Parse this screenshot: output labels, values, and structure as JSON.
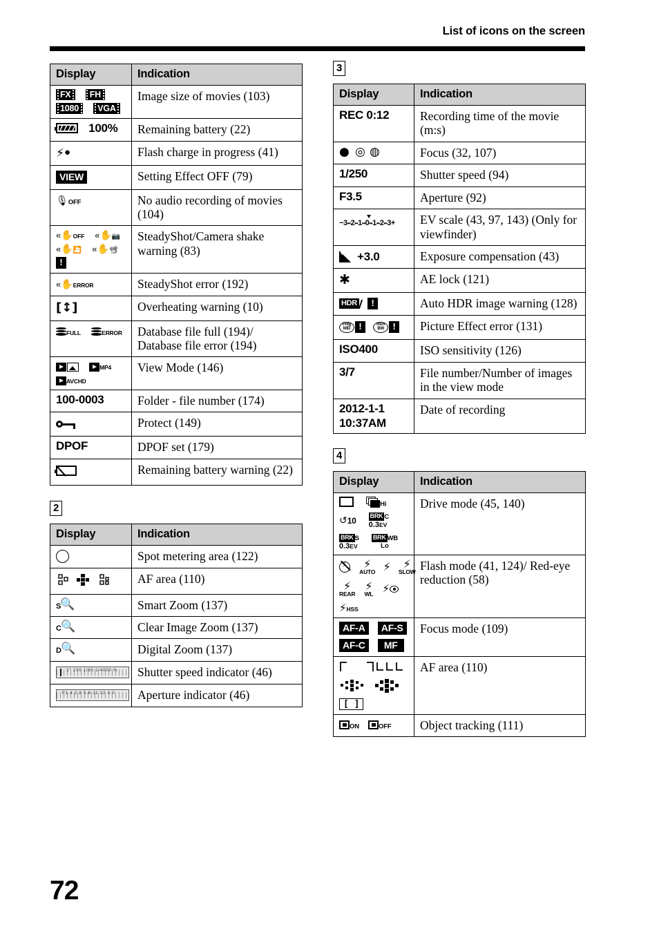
{
  "header": {
    "title": "List of icons on the screen"
  },
  "page_number": "72",
  "columns": {
    "left": {
      "table1": {
        "headers": {
          "display": "Display",
          "indication": "Indication"
        },
        "rows": [
          {
            "icons": "FX / FH / 1080 / VGA film-strip badges",
            "indication": "Image size of movies (103)"
          },
          {
            "icons": "battery-full 100%",
            "indication": "Remaining battery (22)"
          },
          {
            "icons": "flash-charging",
            "indication": "Flash charge in progress (41)"
          },
          {
            "icons": "VIEW",
            "indication": "Setting Effect OFF (79)"
          },
          {
            "icons": "microphone-off",
            "indication": "No audio recording of movies (104)"
          },
          {
            "icons": "steadyshot-variants",
            "indication": "SteadyShot/Camera shake warning (83)"
          },
          {
            "icons": "steadyshot-error",
            "indication": "SteadyShot error (192)"
          },
          {
            "icons": "overheating",
            "indication": "Overheating warning (10)"
          },
          {
            "icons": "database-full / database-error",
            "indication": "Database file full (194)/ Database file error (194)"
          },
          {
            "icons": "view-mode-still / MP4 / AVCHD",
            "indication": "View Mode (146)"
          },
          {
            "icons": "100-0003",
            "indication": "Folder - file number (174)"
          },
          {
            "icons": "protect-key",
            "indication": "Protect (149)"
          },
          {
            "icons": "DPOF",
            "indication": "DPOF set (179)"
          },
          {
            "icons": "battery-empty-warning",
            "indication": "Remaining battery warning (22)"
          }
        ],
        "labels": {
          "film_fx": "FX",
          "film_fh": "FH",
          "film_1080": "1080",
          "film_vga": "VGA",
          "battery_percent": "100%",
          "view_badge": "VIEW",
          "mic_off_sub": "OFF",
          "ss_off_sub": "OFF",
          "ss_error_sub": "ERROR",
          "db_full_sub": "FULL",
          "db_error_sub": "ERROR",
          "vm_mp4_sub": "MP4",
          "vm_avchd_sub": "AVCHD",
          "folder_file": "100-0003",
          "dpof": "DPOF"
        }
      },
      "badge2": "2",
      "table2": {
        "headers": {
          "display": "Display",
          "indication": "Indication"
        },
        "rows": [
          {
            "icons": "spot-metering-circle",
            "indication": "Spot metering area (122)"
          },
          {
            "icons": "af-area-dots",
            "indication": "AF area (110)"
          },
          {
            "icons": "smart-zoom-magnifier",
            "indication": "Smart Zoom (137)"
          },
          {
            "icons": "clear-image-zoom-magnifier",
            "indication": "Clear Image Zoom (137)"
          },
          {
            "icons": "digital-zoom-magnifier",
            "indication": "Digital Zoom (137)"
          },
          {
            "icons": "shutter-speed-scale-strip",
            "indication": "Shutter speed indicator (46)"
          },
          {
            "icons": "aperture-scale-strip",
            "indication": "Aperture indicator (46)"
          }
        ],
        "labels": {
          "smart_prefix": "S",
          "clear_prefix": "C",
          "digital_prefix": "D",
          "shutter_strip_text": "1\" 100  1/60    1/4000 %",
          "aperture_strip_text": "F1.4 2.8  5.6   11   22   4.0"
        }
      }
    },
    "right": {
      "badge3": "3",
      "table3": {
        "headers": {
          "display": "Display",
          "indication": "Indication"
        },
        "rows": [
          {
            "display_text": "REC 0:12",
            "indication": "Recording time of the movie (m:s)"
          },
          {
            "display_text": "focus-indicators",
            "indication": "Focus (32, 107)"
          },
          {
            "display_text": "1/250",
            "indication": "Shutter speed (94)"
          },
          {
            "display_text": "F3.5",
            "indication": "Aperture (92)"
          },
          {
            "display_text": "ev-scale",
            "indication": "EV scale (43, 97, 143) (Only for viewfinder)"
          },
          {
            "display_text": "+3.0",
            "indication": "Exposure compensation (43)"
          },
          {
            "display_text": "ae-lock-asterisk",
            "indication": "AE lock (121)"
          },
          {
            "display_text": "hdr-warning",
            "indication": "Auto HDR image warning (128)"
          },
          {
            "display_text": "picture-effect-errors",
            "indication": "Picture Effect error (131)"
          },
          {
            "display_text": "ISO400",
            "indication": "ISO sensitivity (126)"
          },
          {
            "display_text": "3/7",
            "indication": "File number/Number of images in the view mode"
          },
          {
            "display_text": "2012-1-1 10:37AM",
            "indication": "Date of recording"
          }
        ],
        "labels": {
          "rec_time": "REC 0:12",
          "shutter_speed": "1/250",
          "aperture": "F3.5",
          "ev_scale_text": "-3 2 1 0 1 2 3+",
          "exposure_comp": "+3.0",
          "ae_lock": "✱",
          "hdr": "HDR",
          "pfx1": "Pntg MID",
          "pfx2": "Rich BW",
          "iso": "ISO400",
          "file_number": "3/7",
          "date_line1": "2012-1-1",
          "date_line2": "10:37AM"
        }
      },
      "badge4": "4",
      "table4": {
        "headers": {
          "display": "Display",
          "indication": "Indication"
        },
        "rows": [
          {
            "icons": "drive-mode-icons",
            "indication": "Drive mode (45, 140)"
          },
          {
            "icons": "flash-mode-icons",
            "indication": "Flash mode (41, 124)/ Red-eye reduction (58)"
          },
          {
            "icons": "focus-mode-badges",
            "indication": "Focus mode (109)"
          },
          {
            "icons": "af-area-icons",
            "indication": "AF area (110)"
          },
          {
            "icons": "object-tracking-on-off",
            "indication": "Object tracking (111)"
          }
        ],
        "labels": {
          "drive_hi": "Hi",
          "drive_timer": "10",
          "brk": "BRK",
          "brk_c": "C",
          "brk_c_ev": "0.3",
          "brk_ev_unit": "EV",
          "brk_s": "S",
          "brk_s_ev": "0.3",
          "brk_wb": "WB",
          "brk_wb_lo": "Lo",
          "flash_auto": "AUTO",
          "flash_slow": "SLOW",
          "flash_rear": "REAR",
          "flash_wl": "WL",
          "flash_hss": "HSS",
          "focus_af_a": "AF-A",
          "focus_af_s": "AF-S",
          "focus_af_c": "AF-C",
          "focus_mf": "MF",
          "track_on": "ON",
          "track_off": "OFF"
        }
      }
    }
  },
  "colors": {
    "header_bg": "#cfcfcf",
    "rule": "#000000",
    "text": "#000000",
    "page_bg": "#ffffff"
  }
}
